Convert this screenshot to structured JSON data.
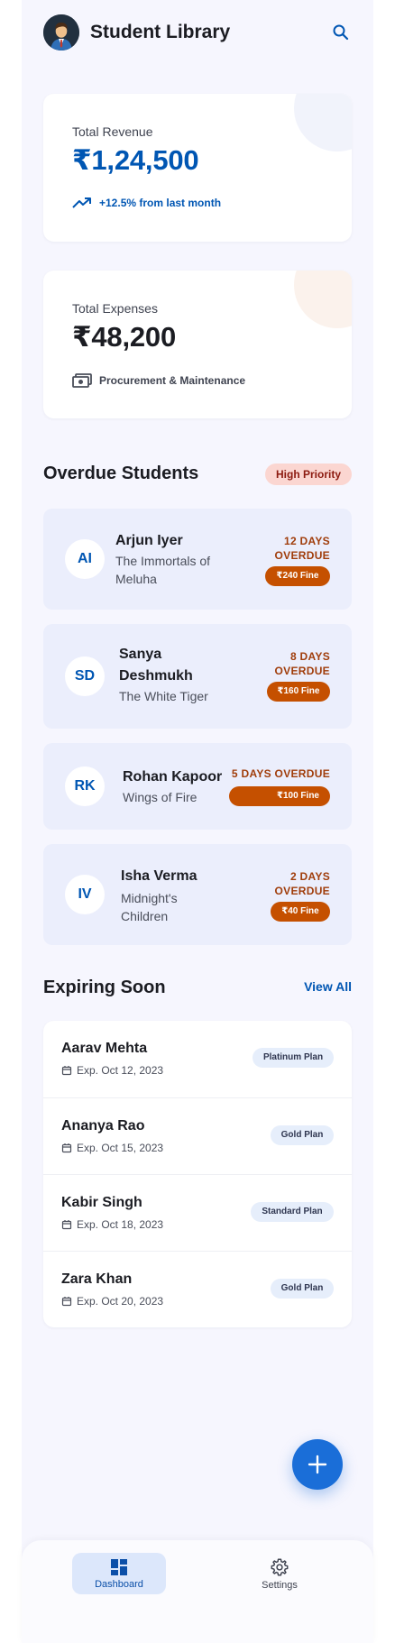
{
  "header": {
    "title": "Student Library",
    "avatar_icon": "user-avatar",
    "search_icon": "search-icon"
  },
  "revenue": {
    "label": "Total Revenue",
    "value": "₹1,24,500",
    "trend": "+12.5% from last month",
    "trend_icon": "trending-up-icon",
    "accent": "#0056b3"
  },
  "expenses": {
    "label": "Total Expenses",
    "value": "₹48,200",
    "note": "Procurement & Maintenance",
    "note_icon": "cash-icon"
  },
  "overdue": {
    "title": "Overdue Students",
    "priority": "High Priority",
    "students": [
      {
        "initials": "AI",
        "name": "Arjun Iyer",
        "book": "The Immortals of Meluha",
        "days": "12 DAYS OVERDUE",
        "fine": "₹240 Fine"
      },
      {
        "initials": "SD",
        "name": "Sanya Deshmukh",
        "book": "The White Tiger",
        "days": "8 DAYS OVERDUE",
        "fine": "₹160 Fine"
      },
      {
        "initials": "RK",
        "name": "Rohan Kapoor",
        "book": "Wings of Fire",
        "days": "5 DAYS OVERDUE",
        "fine": "₹100 Fine"
      },
      {
        "initials": "IV",
        "name": "Isha Verma",
        "book": "Midnight's Children",
        "days": "2 DAYS OVERDUE",
        "fine": "₹40 Fine"
      }
    ]
  },
  "expiring": {
    "title": "Expiring Soon",
    "view_all": "View All",
    "members": [
      {
        "name": "Aarav Mehta",
        "date": "Exp. Oct 12, 2023",
        "plan": "Platinum Plan"
      },
      {
        "name": "Ananya Rao",
        "date": "Exp. Oct 15, 2023",
        "plan": "Gold Plan"
      },
      {
        "name": "Kabir Singh",
        "date": "Exp. Oct 18, 2023",
        "plan": "Standard Plan"
      },
      {
        "name": "Zara Khan",
        "date": "Exp. Oct 20, 2023",
        "plan": "Gold Plan"
      }
    ]
  },
  "fab": {
    "icon": "plus-icon"
  },
  "nav": {
    "items": [
      {
        "label": "Dashboard",
        "icon": "dashboard-icon",
        "active": true
      },
      {
        "label": "Settings",
        "icon": "gear-icon",
        "active": false
      }
    ]
  }
}
